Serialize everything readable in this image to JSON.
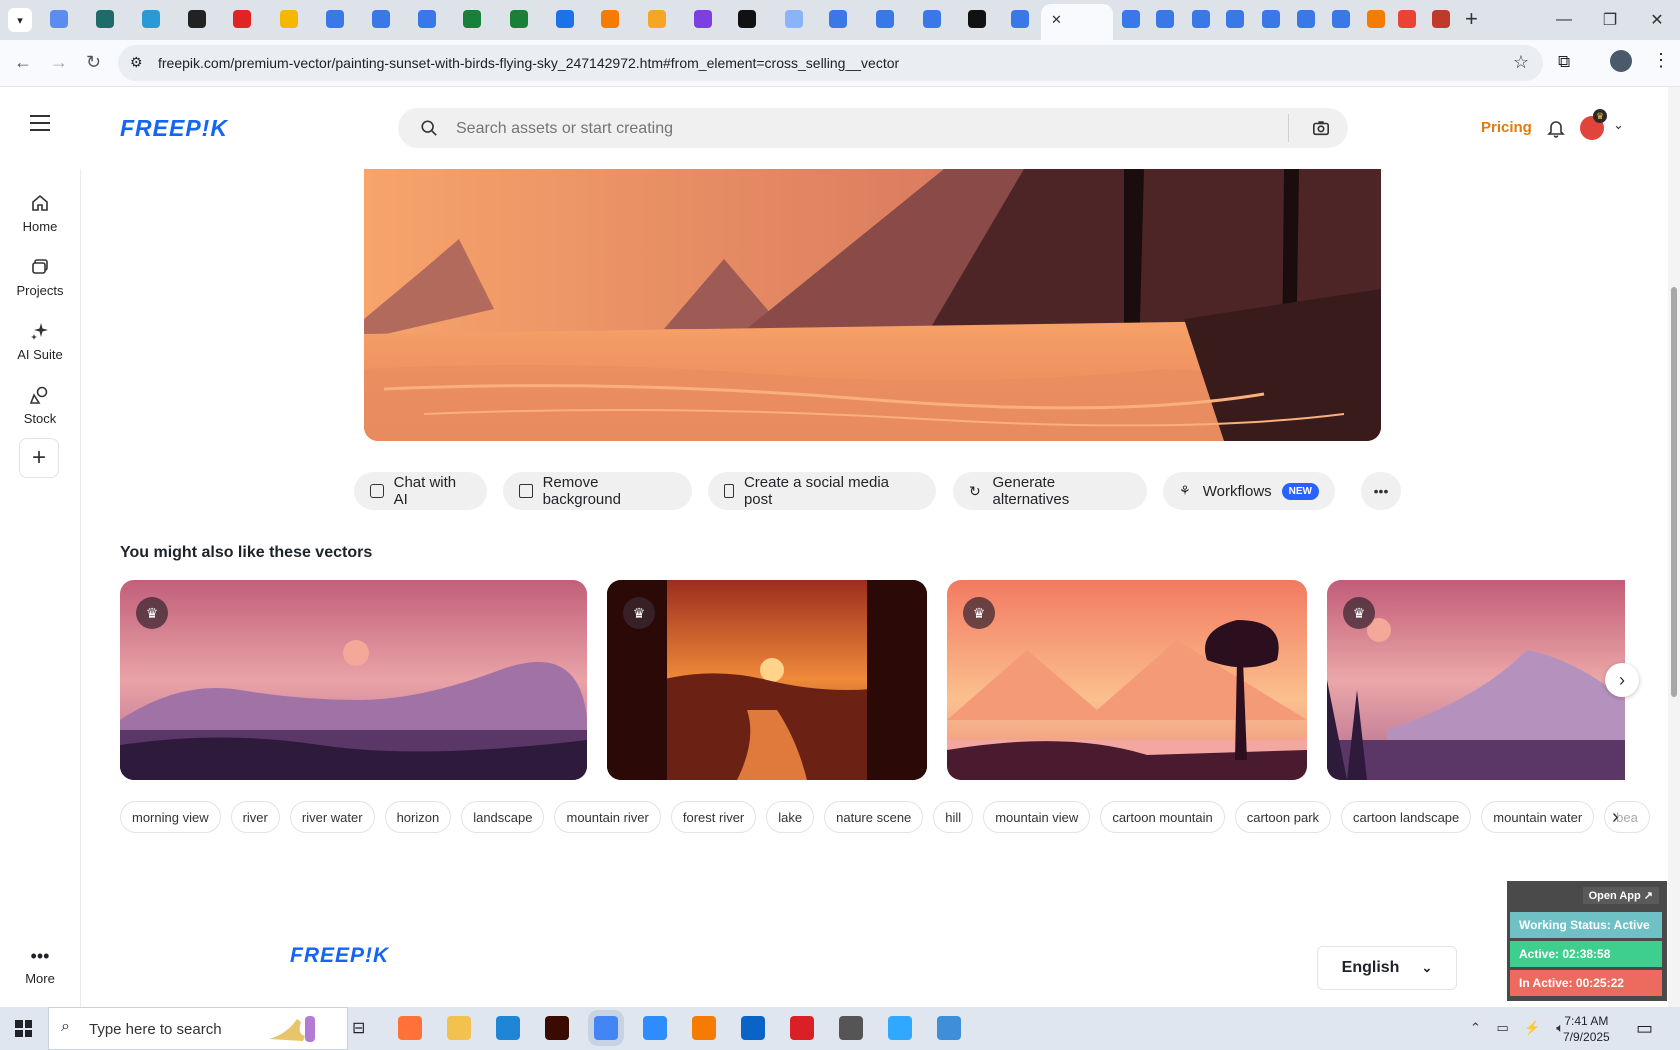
{
  "browser": {
    "url": "freepik.com/premium-vector/painting-sunset-with-birds-flying-sky_247142972.htm#from_element=cross_selling__vector",
    "tab_favicon_colors": [
      "#5b8def",
      "#1e6b6b",
      "#2a9ad6",
      "#222222",
      "#e02424",
      "#f5b700",
      "#3b78e7",
      "#3b78e7",
      "#3b78e7",
      "#188038",
      "#188038",
      "#1a73e8",
      "#f57c00",
      "#f5a623",
      "#7b3fe4",
      "#111111",
      "#8ab4f8",
      "#3b78e7",
      "#3b78e7",
      "#3b78e7",
      "#111111",
      "#3b78e7",
      "#3b78e7",
      "#3b78e7",
      "#3b78e7",
      "#3b78e7",
      "#3b78e7",
      "#3b78e7",
      "#3b78e7",
      "#3b78e7",
      "#f57c00",
      "#ea4335",
      "#c0392b"
    ],
    "new_tab_symbol": "+",
    "close_tab_symbol": "✕"
  },
  "header": {
    "logo": "FREEP!K",
    "search_placeholder": "Search assets or start creating",
    "pricing": "Pricing"
  },
  "sidebar": {
    "items": [
      {
        "label": "Home",
        "icon": "home-icon"
      },
      {
        "label": "Projects",
        "icon": "folder-icon"
      },
      {
        "label": "AI Suite",
        "icon": "sparkles-icon"
      },
      {
        "label": "Stock",
        "icon": "shapes-icon"
      }
    ],
    "more_label": "More"
  },
  "tools": [
    {
      "label": "Chat with AI"
    },
    {
      "label": "Remove background"
    },
    {
      "label": "Create a social media post"
    },
    {
      "label": "Generate alternatives"
    },
    {
      "label": "Workflows",
      "badge": "NEW"
    }
  ],
  "related": {
    "title": "You might also like these vectors"
  },
  "tags": [
    "morning view",
    "river",
    "river water",
    "horizon",
    "landscape",
    "mountain river",
    "forest river",
    "lake",
    "nature scene",
    "hill",
    "mountain view",
    "cartoon mountain",
    "cartoon park",
    "cartoon landscape",
    "mountain water",
    "bea"
  ],
  "footer": {
    "logo": "FREEP!K",
    "language": "English"
  },
  "widget": {
    "open_app": "Open App ↗",
    "working_status": "Working Status: Active",
    "active": "Active: 02:38:58",
    "inactive": "In Active: 00:25:22"
  },
  "taskbar": {
    "search_placeholder": "Type here to search",
    "time": "7:41 AM",
    "date": "7/9/2025",
    "apps": [
      "firefox-icon",
      "file-explorer-icon",
      "vscode-icon",
      "illustrator-icon",
      "chrome-icon",
      "zoom-icon",
      "xampp-icon",
      "outlook-icon",
      "creative-cloud-icon",
      "pen-icon",
      "photoshop-icon",
      "app-icon"
    ]
  },
  "colors": {
    "brand_blue": "#1464f6",
    "pricing_orange": "#e07a12",
    "status_active": "#3ecf8e",
    "status_inactive": "#ec6a5e"
  }
}
